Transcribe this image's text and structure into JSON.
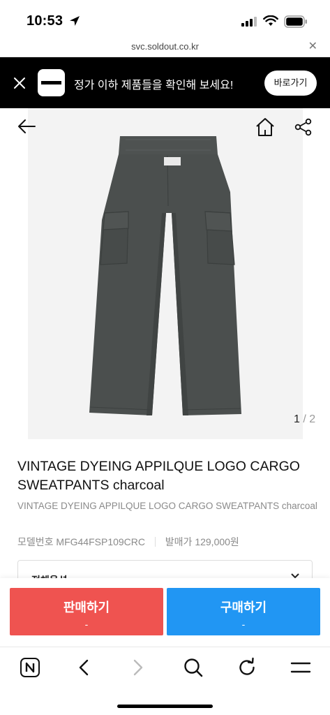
{
  "status_bar": {
    "time": "10:53"
  },
  "url_bar": {
    "url": "svc.soldout.co.kr",
    "close_label": "✕"
  },
  "banner": {
    "message": "정가 이하 제품들을 확인해 보세요!",
    "button_label": "바로가기"
  },
  "gallery": {
    "current_page": "1",
    "separator": " / ",
    "total_pages": "2"
  },
  "product": {
    "title": "VINTAGE DYEING APPILQUE LOGO CARGO SWEATPANTS charcoal",
    "subtitle": "VINTAGE DYEING APPILQUE LOGO CARGO SWEATPANTS charcoal",
    "model_label": "모델번호",
    "model_value": "MFG44FSP109CRC",
    "release_price_label": "발매가",
    "release_price_value": "129,000원",
    "option_label": "전체옵션"
  },
  "actions": {
    "sell_label": "판매하기",
    "sell_price": "-",
    "buy_label": "구매하기",
    "buy_price": "-"
  },
  "colors": {
    "sell": "#ef5350",
    "buy": "#2196f3",
    "banner": "#000000",
    "pants": "#4b4f4e"
  }
}
